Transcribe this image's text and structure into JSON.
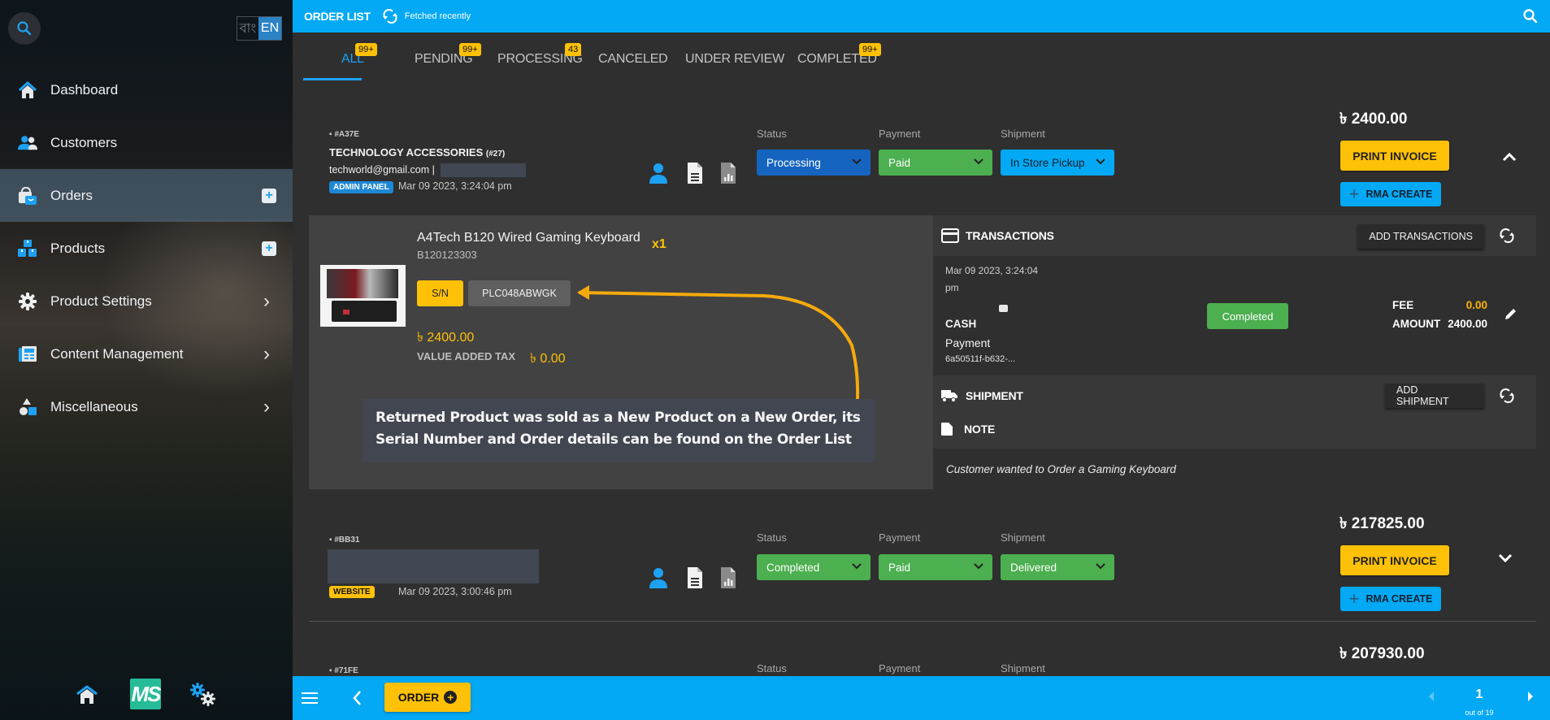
{
  "sidebar": {
    "language": {
      "bangla": "বাং",
      "english": "EN",
      "selected": "EN"
    },
    "items": [
      {
        "label": "Dashboard",
        "icon": "home-icon"
      },
      {
        "label": "Customers",
        "icon": "customers-icon"
      },
      {
        "label": "Orders",
        "icon": "orders-bag-icon",
        "active": true,
        "has_add": true
      },
      {
        "label": "Products",
        "icon": "products-boxes-icon",
        "has_add": true
      },
      {
        "label": "Product Settings",
        "icon": "gear-icon",
        "has_submenu": true
      },
      {
        "label": "Content Management",
        "icon": "newspaper-icon",
        "has_submenu": true
      },
      {
        "label": "Miscellaneous",
        "icon": "shapes-icon",
        "has_submenu": true
      }
    ],
    "add_symbol": "+",
    "submenu_symbol": "›",
    "bottom": {
      "logo_text": "MS"
    }
  },
  "topbar": {
    "title": "ORDER LIST",
    "fetch_status": "Fetched recently"
  },
  "tabs": [
    {
      "label": "ALL",
      "badge": "99+",
      "active": true
    },
    {
      "label": "PENDING",
      "badge": "99+"
    },
    {
      "label": "PROCESSING",
      "badge": "43"
    },
    {
      "label": "CANCELED",
      "badge": ""
    },
    {
      "label": "UNDER REVIEW",
      "badge": ""
    },
    {
      "label": "COMPLETED",
      "badge": "99+"
    }
  ],
  "labels": {
    "status": "Status",
    "payment": "Payment",
    "shipment": "Shipment",
    "print_invoice": "PRINT INVOICE",
    "rma_create": "RMA CREATE",
    "currency": "৳"
  },
  "orders": [
    {
      "id": "#A37E",
      "customer": "TECHNOLOGY ACCESSORIES",
      "customer_no": "(#27)",
      "email": "techworld@gmail.com |",
      "source": "ADMIN PANEL",
      "date": "Mar 09 2023, 3:24:04 pm",
      "status": "Processing",
      "payment": "Paid",
      "shipment": "In Store Pickup",
      "total": "৳ 2400.00",
      "expanded": true
    },
    {
      "id": "#BB31",
      "customer": "",
      "source": "WEBSITE",
      "date": "Mar 09 2023, 3:00:46 pm",
      "status": "Completed",
      "payment": "Paid",
      "shipment": "Delivered",
      "total": "৳ 217825.00",
      "expanded": false
    },
    {
      "id": "#71FE",
      "total": "৳ 207930.00"
    }
  ],
  "detail": {
    "item": {
      "name": "A4Tech B120 Wired Gaming Keyboard",
      "sku": "B120123303",
      "qty": "x1",
      "sn_label": "S/N",
      "serial": "PLC048ABWGK",
      "price": "৳ 2400.00",
      "vat_label": "VALUE ADDED TAX",
      "vat": "৳ 0.00"
    },
    "transactions": {
      "title": "TRANSACTIONS",
      "add_button": "ADD TRANSACTIONS",
      "row": {
        "date_line1": "Mar 09 2023, 3:24:04",
        "date_line2": "pm",
        "method": "CASH",
        "type": "Payment",
        "ref": "6a50511f-b632-...",
        "status": "Completed",
        "fee_label": "FEE",
        "fee": "0.00",
        "amount_label": "AMOUNT",
        "amount": "2400.00"
      }
    },
    "shipment": {
      "title": "SHIPMENT",
      "add_button": "ADD SHIPMENT"
    },
    "note": {
      "title": "NOTE",
      "text": "Customer wanted to Order a Gaming Keyboard"
    }
  },
  "annotation": {
    "text": "Returned Product was sold as a New Product on a New Order, its Serial Number and Order details can be found on the Order List"
  },
  "bottombar": {
    "order_button": "ORDER",
    "page": "1",
    "page_total": "out of 19"
  },
  "colors": {
    "accent": "#03a9f4",
    "warning": "#ffc107",
    "status_processing": "#1565c0",
    "status_green": "#4caf50",
    "shipment_pickup": "#03a9f4"
  }
}
